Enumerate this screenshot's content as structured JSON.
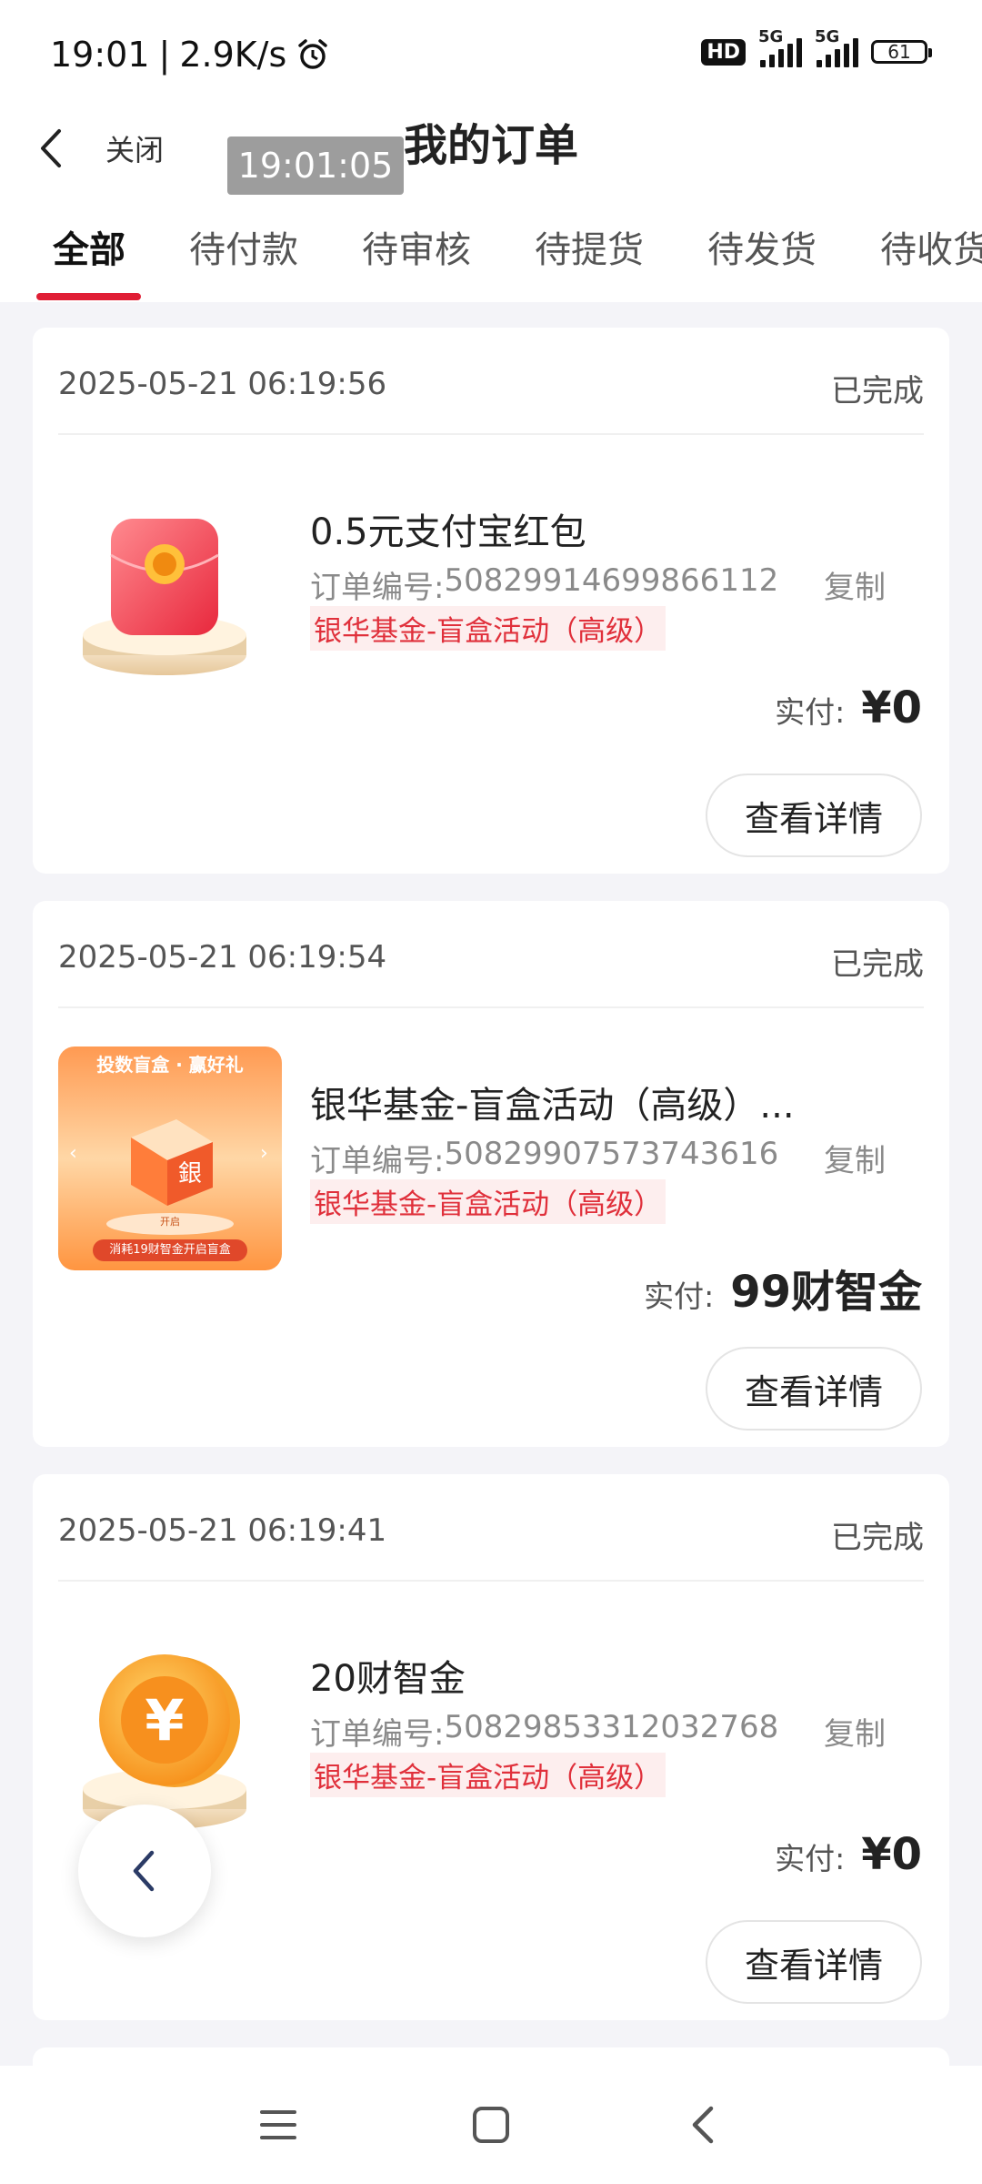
{
  "status_bar": {
    "time": "19:01",
    "separator": "|",
    "speed": "2.9K/s",
    "hd": "HD",
    "net1": "5G",
    "net2": "5G",
    "battery": "61"
  },
  "header": {
    "close_label": "关闭",
    "title": "我的订单",
    "time_overlay": "19:01:05"
  },
  "tabs": [
    {
      "label": "全部",
      "active": true
    },
    {
      "label": "待付款"
    },
    {
      "label": "待审核"
    },
    {
      "label": "待提货"
    },
    {
      "label": "待发货"
    },
    {
      "label": "待收货"
    }
  ],
  "orders": [
    {
      "date": "2025-05-21 06:19:56",
      "status": "已完成",
      "product_name": "0.5元支付宝红包",
      "order_no_label": "订单编号:",
      "order_no": "5082991469986611​2",
      "copy_label": "复制",
      "campaign": "银华基金-盲盒活动（高级）",
      "paid_label": "实付:",
      "paid_value": "¥0",
      "detail_label": "查看详情",
      "thumb_icon": "red-envelope-icon"
    },
    {
      "date": "2025-05-21 06:19:54",
      "status": "已完成",
      "product_name": "银华基金-盲盒活动（高级）...",
      "order_no_label": "订单编号:",
      "order_no": "50829907573743616",
      "copy_label": "复制",
      "campaign": "银华基金-盲盒活动（高级）",
      "paid_label": "实付:",
      "paid_value": "99财智金",
      "detail_label": "查看详情",
      "thumb_icon": "blind-box-icon",
      "thumb_text_top": "投数盲盒 · 赢好礼",
      "thumb_text_bottom": "消耗19财智金开启盲盒"
    },
    {
      "date": "2025-05-21 06:19:41",
      "status": "已完成",
      "product_name": "20财智金",
      "order_no_label": "订单编号:",
      "order_no": "50829853312032768",
      "copy_label": "复制",
      "campaign": "银华基金-盲盒活动（高级）",
      "paid_label": "实付:",
      "paid_value": "¥0",
      "detail_label": "查看详情",
      "thumb_icon": "gold-coin-icon",
      "thumb_symbol": "¥"
    }
  ],
  "colors": {
    "accent": "#e01e35",
    "campaign_text": "#e0303b",
    "campaign_bg": "#fdeeee",
    "page_bg": "#f4f4f8"
  }
}
